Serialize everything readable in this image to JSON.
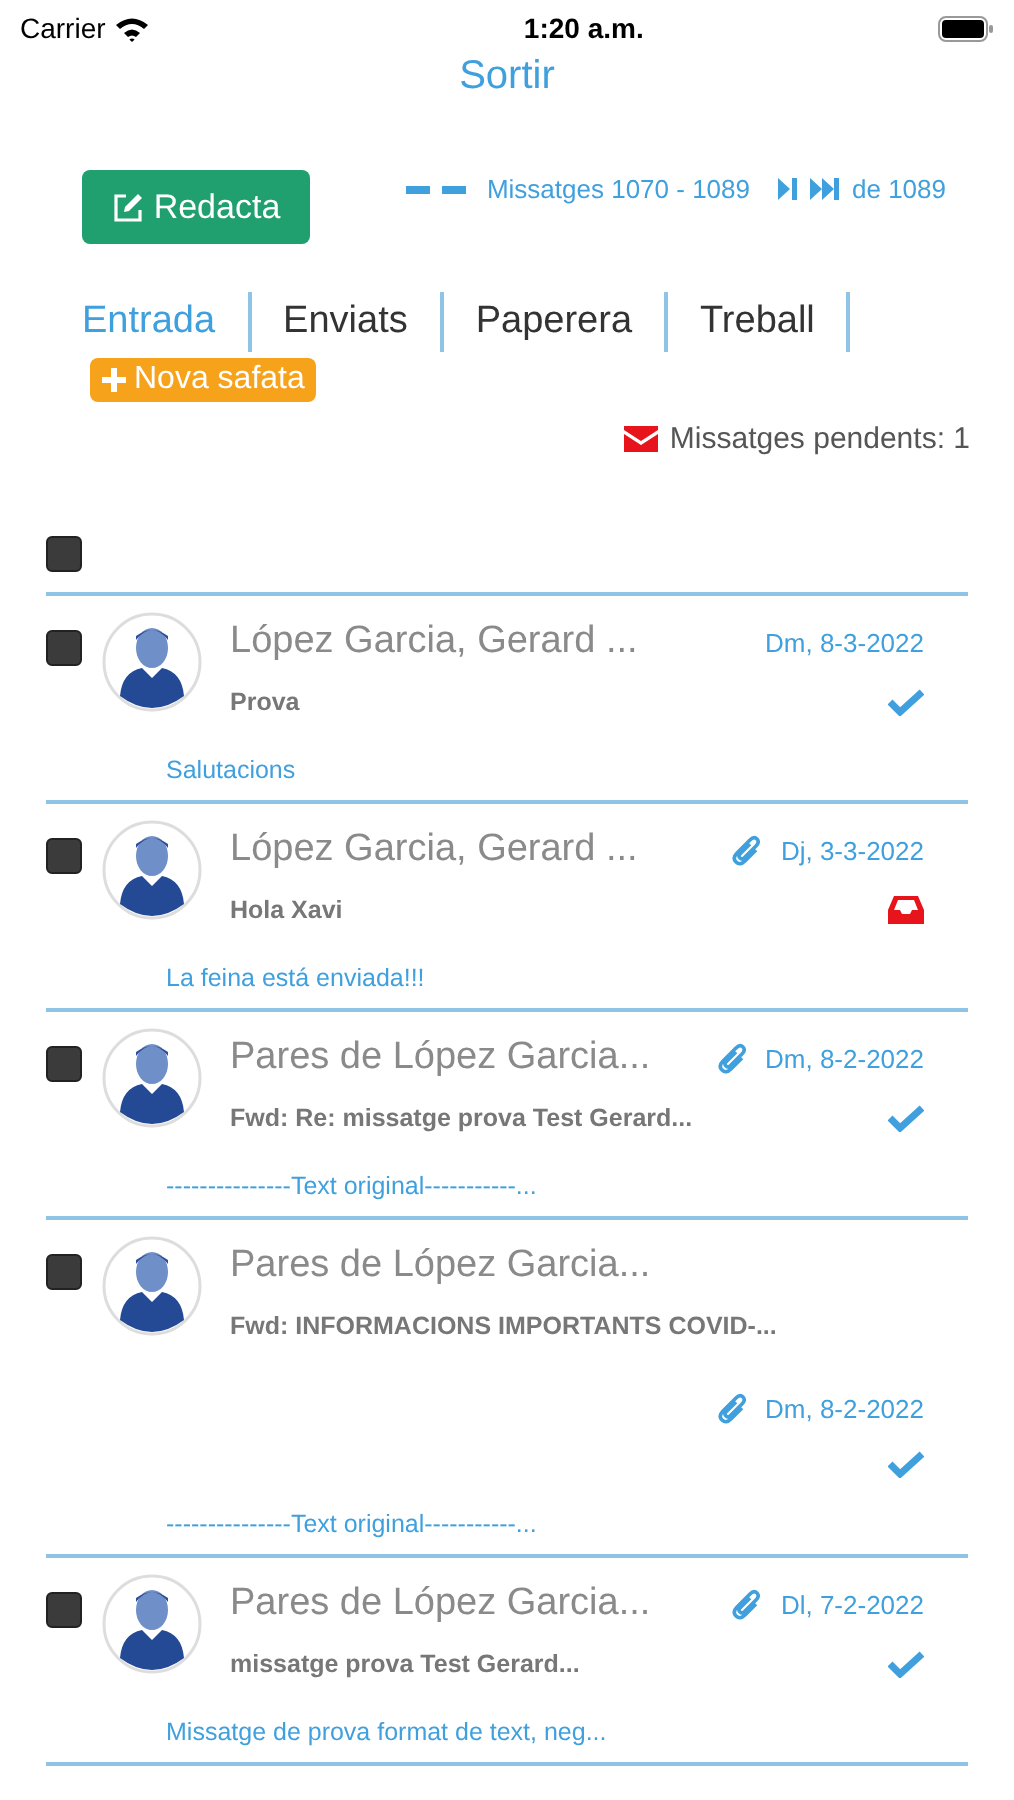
{
  "status_bar": {
    "carrier": "Carrier",
    "time": "1:20 a.m."
  },
  "header": {
    "logout": "Sortir"
  },
  "toolbar": {
    "compose": "Redacta",
    "range": "Missatges 1070 - 1089",
    "total": "de 1089"
  },
  "tabs": [
    {
      "label": "Entrada",
      "selected": true
    },
    {
      "label": "Enviats",
      "selected": false
    },
    {
      "label": "Paperera",
      "selected": false
    },
    {
      "label": "Treball",
      "selected": false
    }
  ],
  "new_folder": "Nova safata",
  "pending": "Missatges pendents: 1",
  "select_all": {
    "checked": false
  },
  "messages": [
    {
      "sender": "López Garcia, Gerard ...",
      "subject": "Prova",
      "preview": "Salutacions",
      "date": "Dm, 8-3-2022",
      "attachment": false,
      "read": true,
      "date_below": false,
      "checked": false
    },
    {
      "sender": "López Garcia, Gerard ...",
      "subject": "Hola Xavi",
      "preview": "La feina está enviada!!!",
      "date": "Dj, 3-3-2022",
      "attachment": true,
      "read": false,
      "date_below": false,
      "checked": false
    },
    {
      "sender": "Pares de López Garcia...",
      "subject": "Fwd: Re: missatge prova Test Gerard...",
      "preview": "---------------Text original-----------...",
      "date": "Dm, 8-2-2022",
      "attachment": true,
      "read": true,
      "date_below": false,
      "checked": false
    },
    {
      "sender": "Pares de López Garcia...",
      "subject": "Fwd: INFORMACIONS IMPORTANTS COVID-...",
      "preview": "---------------Text original-----------...",
      "date": "Dm, 8-2-2022",
      "attachment": true,
      "read": true,
      "date_below": true,
      "checked": false
    },
    {
      "sender": "Pares de López Garcia...",
      "subject": "missatge prova Test Gerard...",
      "preview": "Missatge de prova format de text, neg...",
      "date": "Dl, 7-2-2022",
      "attachment": true,
      "read": true,
      "date_below": false,
      "checked": false
    }
  ]
}
